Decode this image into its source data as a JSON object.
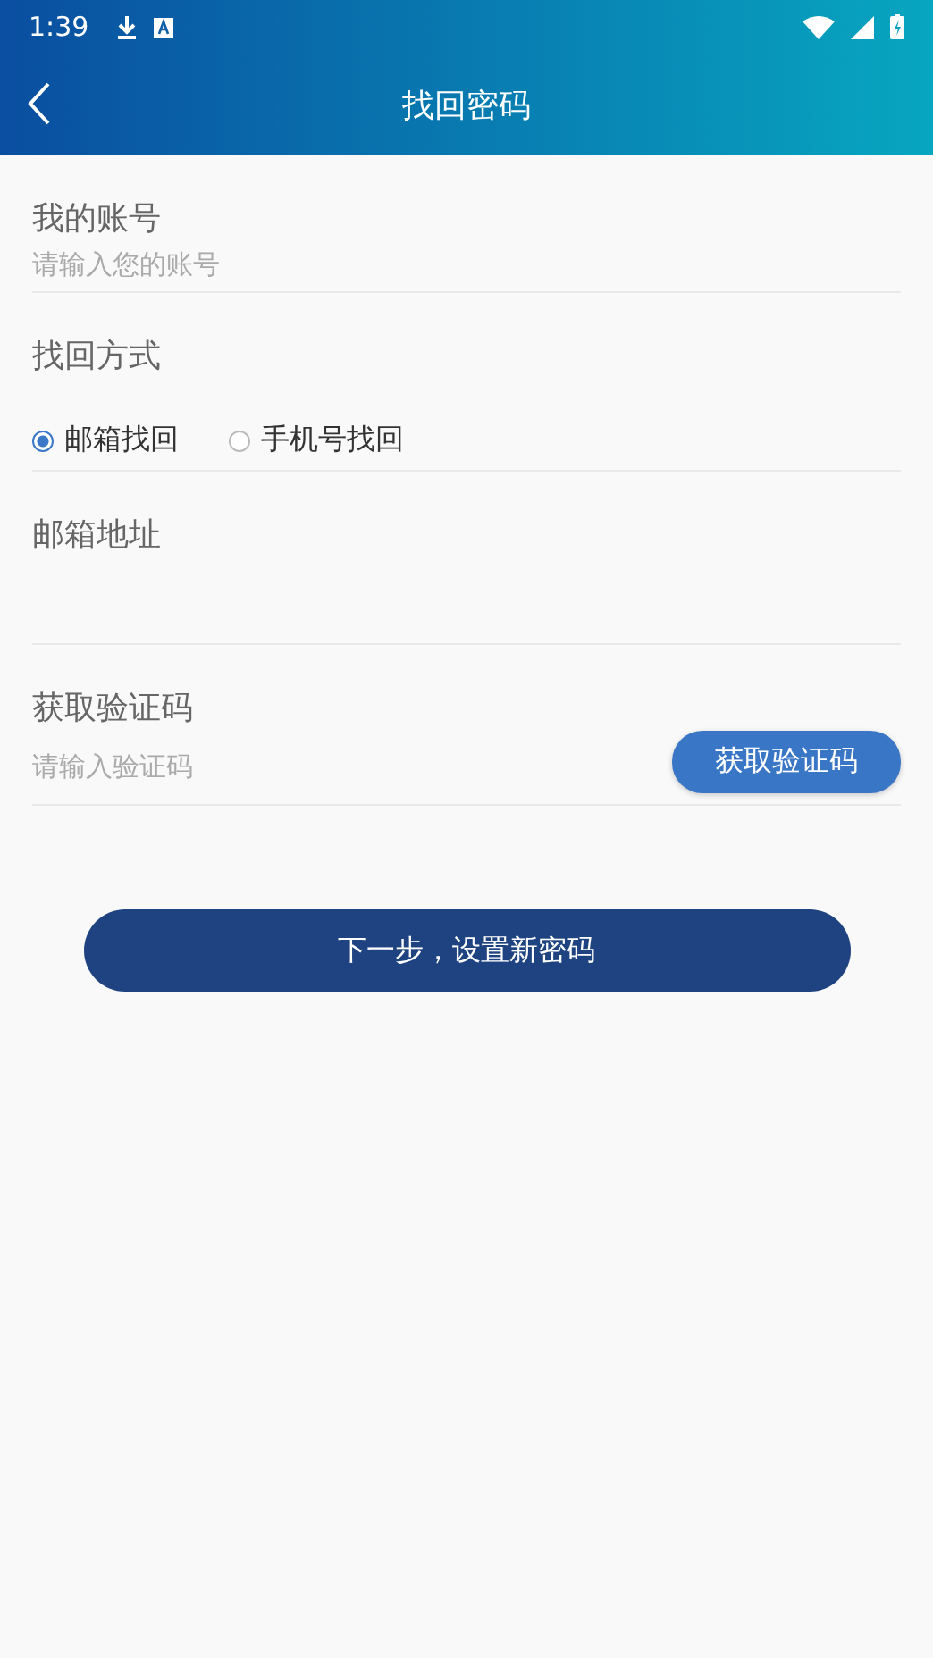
{
  "status_bar": {
    "time": "1:39"
  },
  "header": {
    "title": "找回密码"
  },
  "account": {
    "label": "我的账号",
    "placeholder": "请输入您的账号"
  },
  "method": {
    "label": "找回方式",
    "options": [
      {
        "label": "邮箱找回",
        "selected": true
      },
      {
        "label": "手机号找回",
        "selected": false
      }
    ]
  },
  "email": {
    "label": "邮箱地址"
  },
  "code": {
    "label": "获取验证码",
    "placeholder": "请输入验证码",
    "button": "获取验证码"
  },
  "next_button": "下一步，设置新密码"
}
